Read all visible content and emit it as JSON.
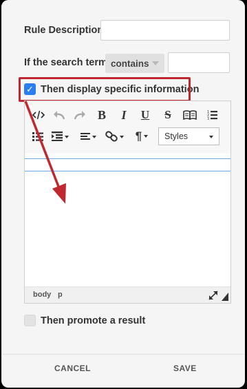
{
  "form": {
    "rule_description_label": "Rule Description",
    "rule_description_value": "",
    "search_term_label": "If the search term",
    "condition_selected": "contains",
    "search_term_value": "",
    "display_info_label": "Then display specific information",
    "display_info_checked": true,
    "promote_result_label": "Then promote a result",
    "promote_result_checked": false
  },
  "editor": {
    "toolbar_icons": [
      "source-code-icon",
      "undo-icon",
      "redo-icon",
      "bold-icon",
      "italic-icon",
      "underline-icon",
      "strikethrough-icon",
      "book-icon",
      "numbered-list-icon",
      "bulleted-list-icon",
      "indent-icon",
      "align-icon",
      "link-icon",
      "paragraph-icon"
    ],
    "bold_glyph": "B",
    "italic_glyph": "I",
    "underline_glyph": "U",
    "strike_glyph": "S",
    "paragraph_glyph": "¶",
    "styles_label": "Styles",
    "path": [
      "body",
      "p"
    ]
  },
  "footer": {
    "cancel_label": "CANCEL",
    "save_label": "SAVE"
  },
  "colors": {
    "accent": "#2a7ef0",
    "annotation_red": "#c0282f",
    "panel_bg": "#f5f5f5"
  }
}
